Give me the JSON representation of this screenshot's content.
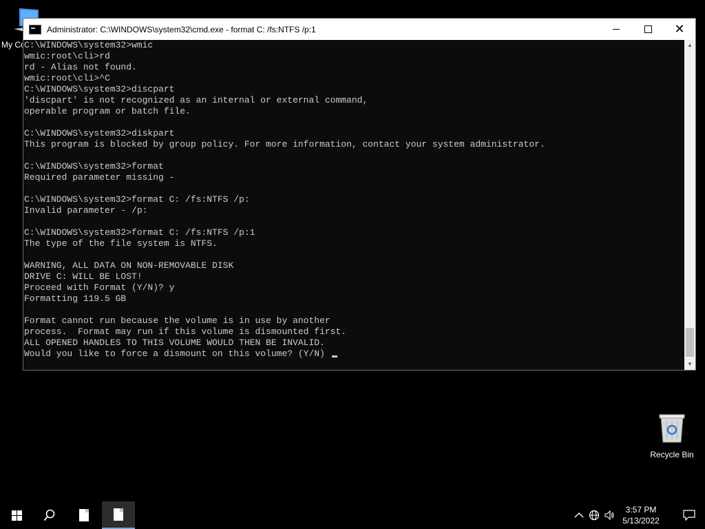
{
  "desktop": {
    "my_computer_label": "My Co",
    "recycle_bin_label": "Recycle Bin"
  },
  "window": {
    "title": "Administrator: C:\\WINDOWS\\system32\\cmd.exe - format  C: /fs:NTFS /p:1",
    "minimize": "minimize",
    "maximize": "maximize",
    "close": "✕"
  },
  "console": {
    "lines": [
      "C:\\WINDOWS\\system32>wmic",
      "wmic:root\\cli>rd",
      "rd - Alias not found.",
      "wmic:root\\cli>^C",
      "C:\\WINDOWS\\system32>discpart",
      "'discpart' is not recognized as an internal or external command,",
      "operable program or batch file.",
      "",
      "C:\\WINDOWS\\system32>diskpart",
      "This program is blocked by group policy. For more information, contact your system administrator.",
      "",
      "C:\\WINDOWS\\system32>format",
      "Required parameter missing -",
      "",
      "C:\\WINDOWS\\system32>format C: /fs:NTFS /p:",
      "Invalid parameter - /p:",
      "",
      "C:\\WINDOWS\\system32>format C: /fs:NTFS /p:1",
      "The type of the file system is NTFS.",
      "",
      "WARNING, ALL DATA ON NON-REMOVABLE DISK",
      "DRIVE C: WILL BE LOST!",
      "Proceed with Format (Y/N)? y",
      "Formatting 119.5 GB",
      "",
      "Format cannot run because the volume is in use by another",
      "process.  Format may run if this volume is dismounted first.",
      "ALL OPENED HANDLES TO THIS VOLUME WOULD THEN BE INVALID.",
      "Would you like to force a dismount on this volume? (Y/N) "
    ]
  },
  "taskbar": {
    "time": "3:57 PM",
    "date": "5/13/2022"
  },
  "icons": {
    "start": "windows-logo-icon",
    "search": "search-icon",
    "app1": "document-icon",
    "app2": "document-icon",
    "chevron": "chevron-up-icon",
    "network": "globe-icon",
    "volume": "speaker-icon",
    "notifications": "action-center-icon"
  }
}
